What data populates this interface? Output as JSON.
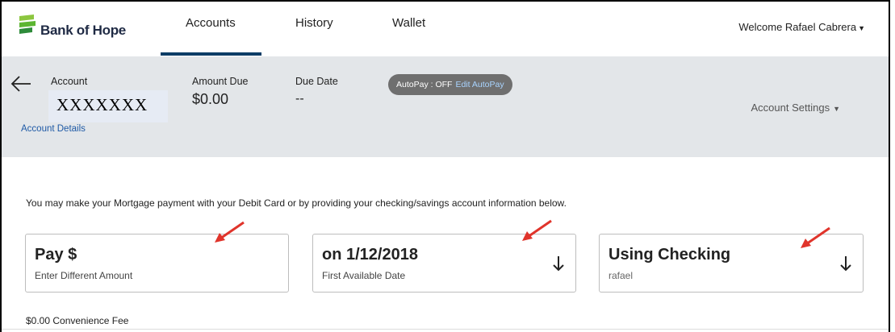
{
  "nav": {
    "brand": "Bank of Hope",
    "tabs": [
      "Accounts",
      "History",
      "Wallet"
    ],
    "active_tab": "Accounts",
    "welcome": "Welcome Rafael Cabrera"
  },
  "account": {
    "account_label": "Account",
    "account_number": "XXXXXXX",
    "amount_due_label": "Amount Due",
    "amount_due": "$0.00",
    "due_date_label": "Due Date",
    "due_date": "--",
    "autopay_status": "AutoPay : OFF",
    "autopay_edit": "Edit AutoPay",
    "settings": "Account Settings",
    "details_link": "Account Details"
  },
  "payment": {
    "info": "You may make your Mortgage payment with your Debit Card or by providing your checking/savings account information below.",
    "amount_card": {
      "title": "Pay $",
      "subtitle": "Enter Different Amount"
    },
    "date_card": {
      "title": "on 1/12/2018",
      "subtitle": "First Available Date"
    },
    "method_card": {
      "title": "Using Checking",
      "subtitle": "rafael"
    },
    "fee": "$0.00 Convenience Fee"
  },
  "colors": {
    "brand_navy": "#0d3d66",
    "band_bg": "#e3e6e9",
    "link_blue": "#1f5aa6",
    "annotation_red": "#e0342b",
    "logo_green": "#5cb531"
  }
}
